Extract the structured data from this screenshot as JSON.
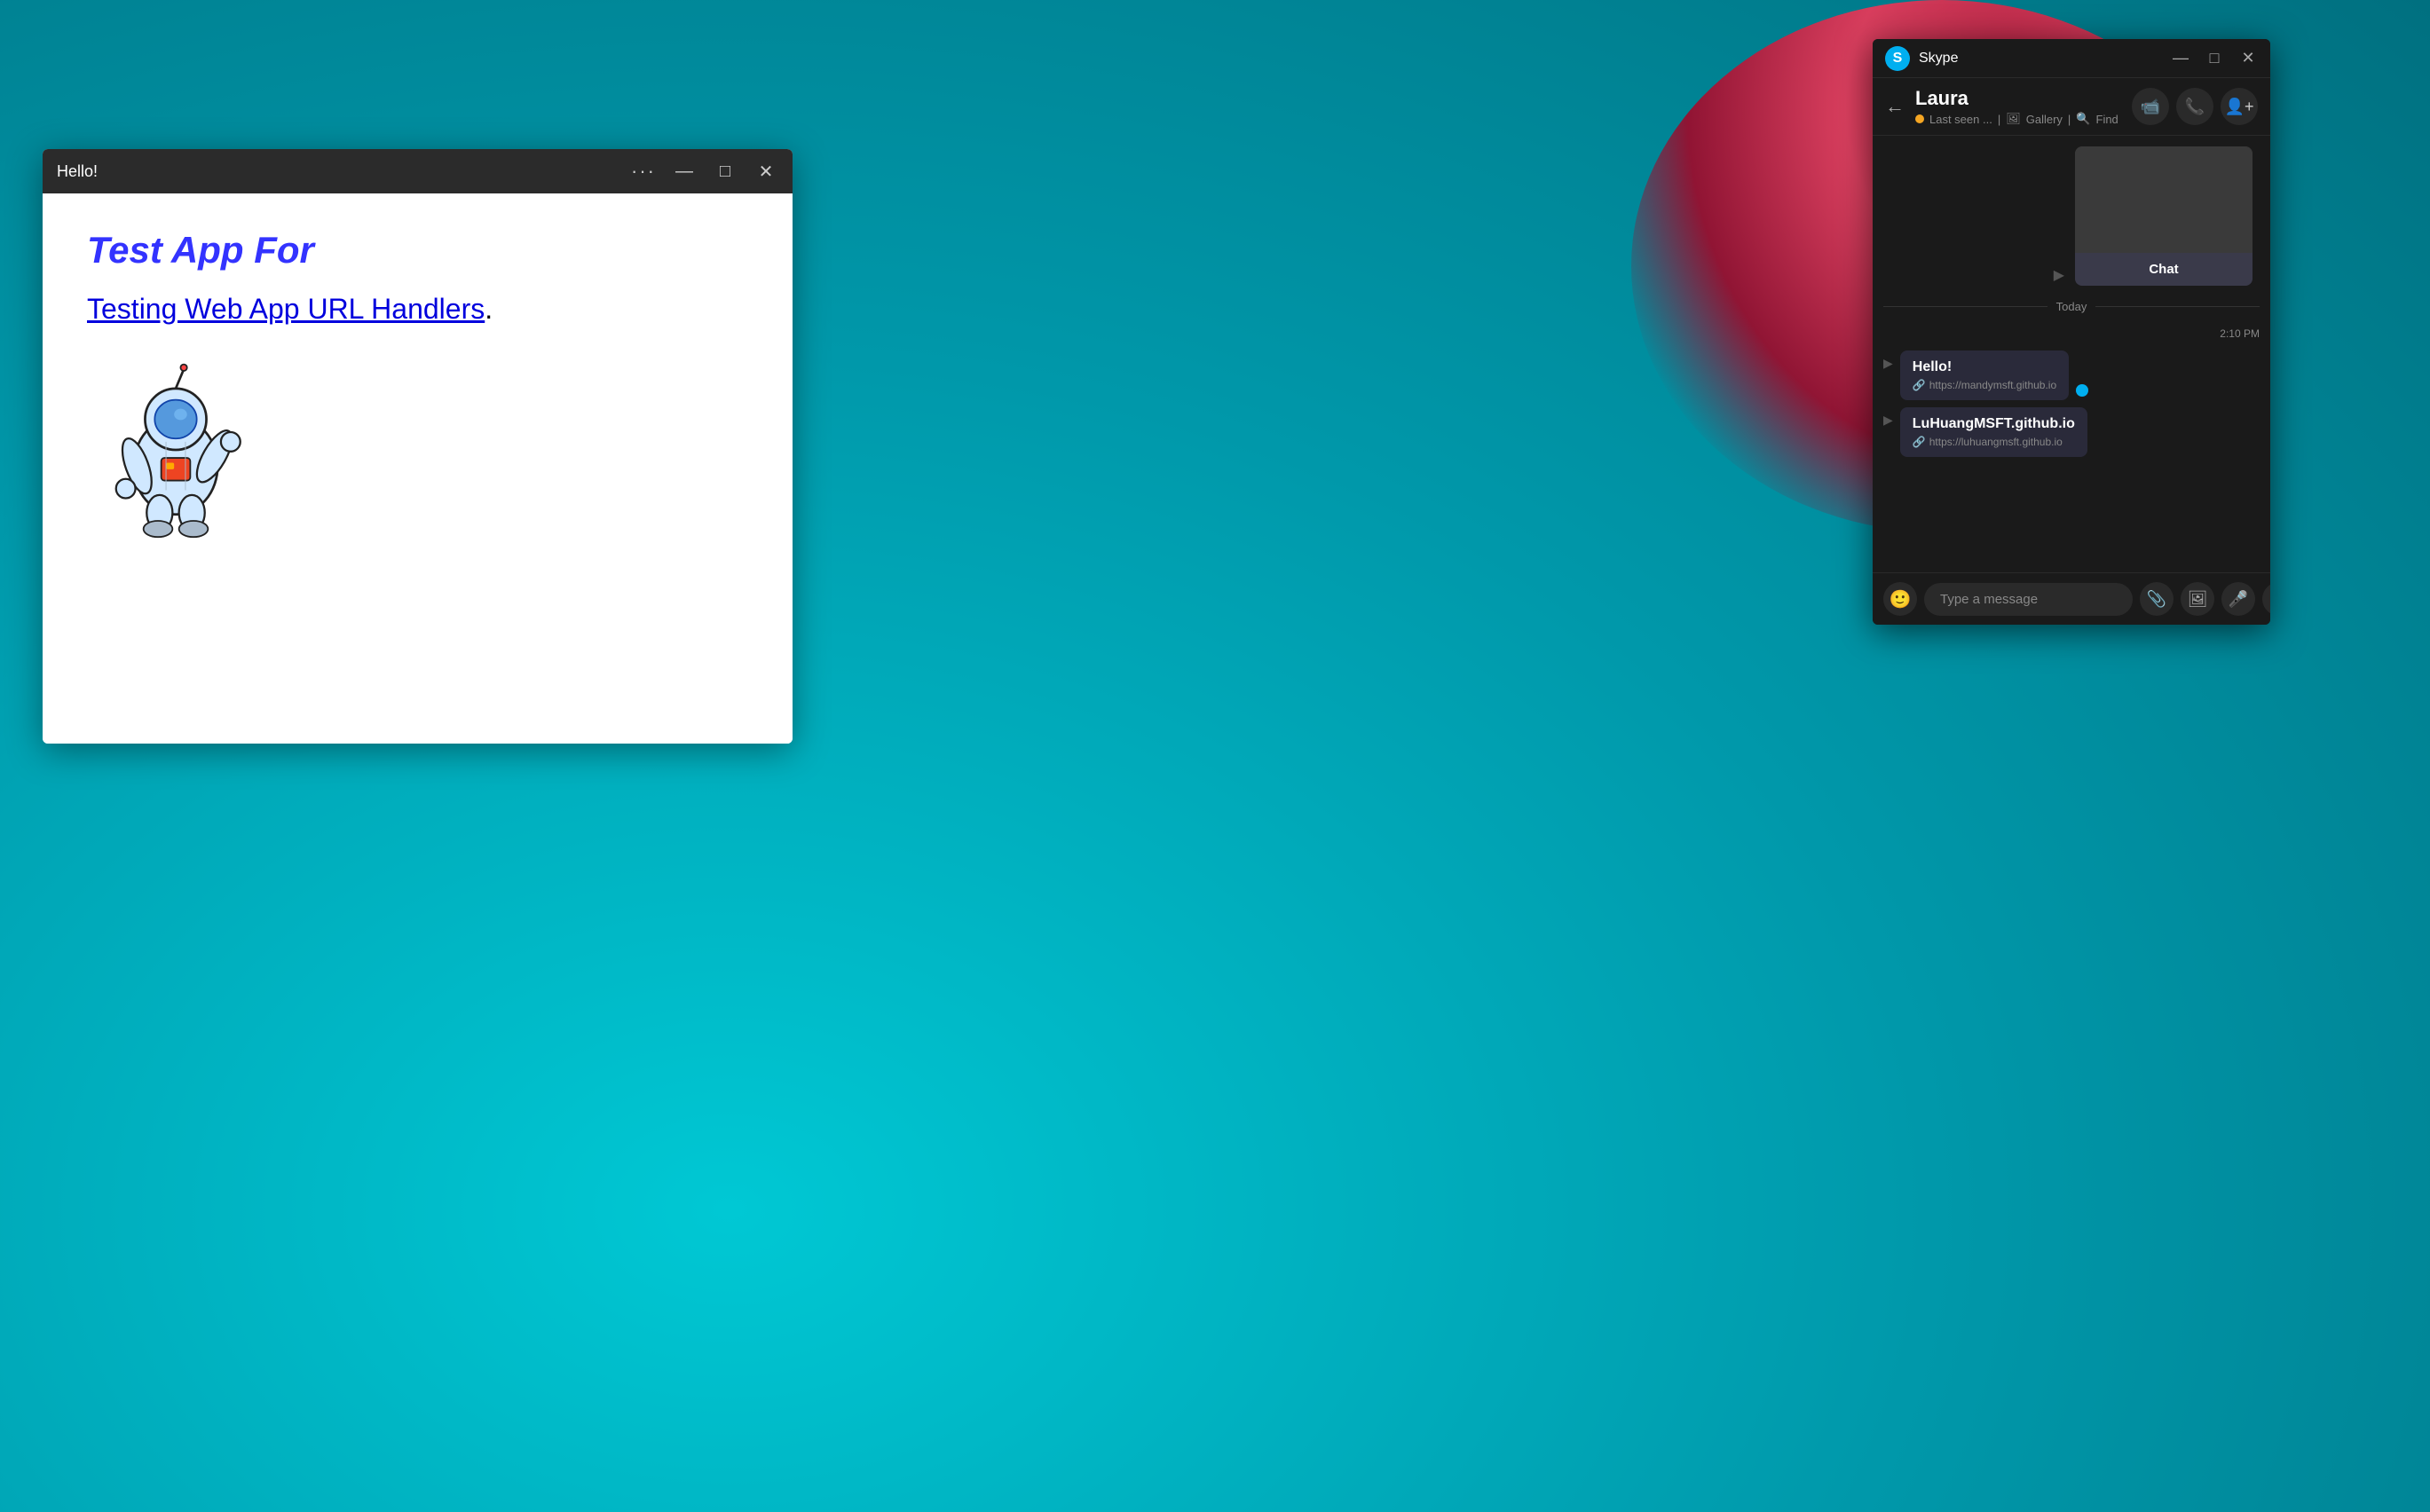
{
  "desktop": {
    "bg_color": "#00b4c8"
  },
  "webapp": {
    "title": "Hello!",
    "titlebar_dots": "···",
    "minimize": "—",
    "maximize": "□",
    "close": "✕",
    "heading": "Test App For",
    "link_text": "Testing Web App URL Handlers",
    "period": "."
  },
  "skype": {
    "app_title": "Skype",
    "logo_letter": "S",
    "minimize": "—",
    "maximize": "□",
    "close": "✕",
    "contact_name": "Laura",
    "contact_status": "Last seen ... | 🖼 Gallery | 🔍 Find",
    "media_preview_label": "Chat",
    "date_divider": "Today",
    "message_time": "2:10 PM",
    "message1_title": "Hello!",
    "message1_link": "https://mandymsft.github.io",
    "message2_title": "LuHuangMSFT.github.io",
    "message2_link": "https://luhuangmsft.github.io",
    "input_placeholder": "Type a message",
    "gallery_label": "Gallery",
    "find_label": "Find"
  },
  "icons": {
    "back": "←",
    "video_call": "📹",
    "voice_call": "📞",
    "add_contact": "👤",
    "emoji": "🙂",
    "attach_file": "📎",
    "image": "🖼",
    "mic": "🎤",
    "more": "···",
    "send": "▶",
    "link": "🔗"
  }
}
